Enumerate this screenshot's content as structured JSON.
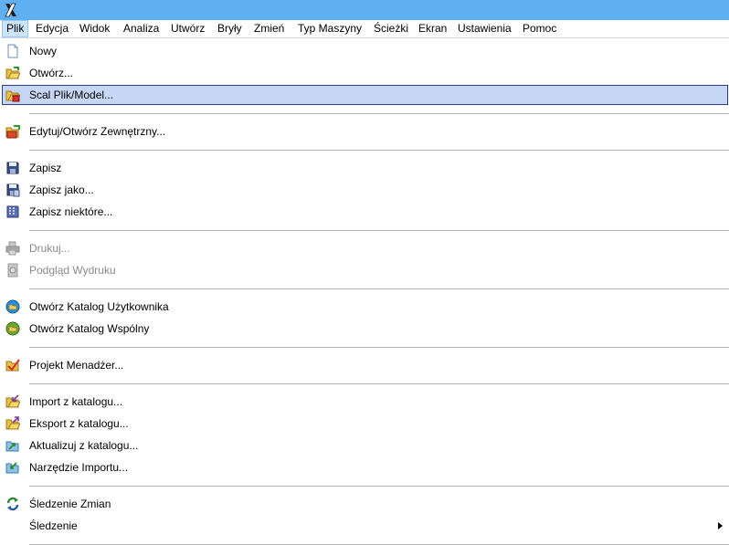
{
  "menubar": {
    "items": [
      "Plik",
      "Edycja",
      "Widok",
      "Analiza",
      "Utwórz",
      "Bryły",
      "Zmień",
      "Typ Maszyny",
      "Ścieżki",
      "Ekran",
      "Ustawienia",
      "Pomoc"
    ],
    "active": "Plik"
  },
  "file_menu": {
    "items": [
      {
        "label": "Nowy",
        "icon": "new-file-icon"
      },
      {
        "label": "Otwórz...",
        "icon": "open-folder-icon"
      },
      {
        "label": "Scal Plik/Model...",
        "icon": "merge-file-icon",
        "highlighted": true
      },
      {
        "label": "Edytuj/Otwórz Zewnętrzny...",
        "icon": "edit-external-icon"
      },
      {
        "label": "Zapisz",
        "icon": "save-icon"
      },
      {
        "label": "Zapisz jako...",
        "icon": "save-as-icon"
      },
      {
        "label": "Zapisz niektóre...",
        "icon": "save-some-icon"
      },
      {
        "label": "Drukuj...",
        "icon": "print-icon",
        "disabled": true
      },
      {
        "label": "Podgląd Wydruku",
        "icon": "print-preview-icon",
        "disabled": true
      },
      {
        "label": "Otwórz Katalog Użytkownika",
        "icon": "user-folder-icon"
      },
      {
        "label": "Otwórz Katalog Wspólny",
        "icon": "shared-folder-icon"
      },
      {
        "label": "Projekt Menadżer...",
        "icon": "project-manager-icon"
      },
      {
        "label": "Import z katalogu...",
        "icon": "import-icon"
      },
      {
        "label": "Eksport z katalogu...",
        "icon": "export-icon"
      },
      {
        "label": "Aktualizuj z katalogu...",
        "icon": "update-icon"
      },
      {
        "label": "Narzędzie Importu...",
        "icon": "import-tool-icon"
      },
      {
        "label": "Śledzenie Zmian",
        "icon": "track-changes-icon"
      },
      {
        "label": "Śledzenie",
        "icon": "",
        "submenu": true
      }
    ]
  },
  "colors": {
    "titlebar": "#5fb0f0",
    "highlight_bg": "#c5d7f5",
    "highlight_border": "#2d3a8c",
    "active_menu_bg": "#cce4f7",
    "disabled_text": "#8a8a8a"
  }
}
